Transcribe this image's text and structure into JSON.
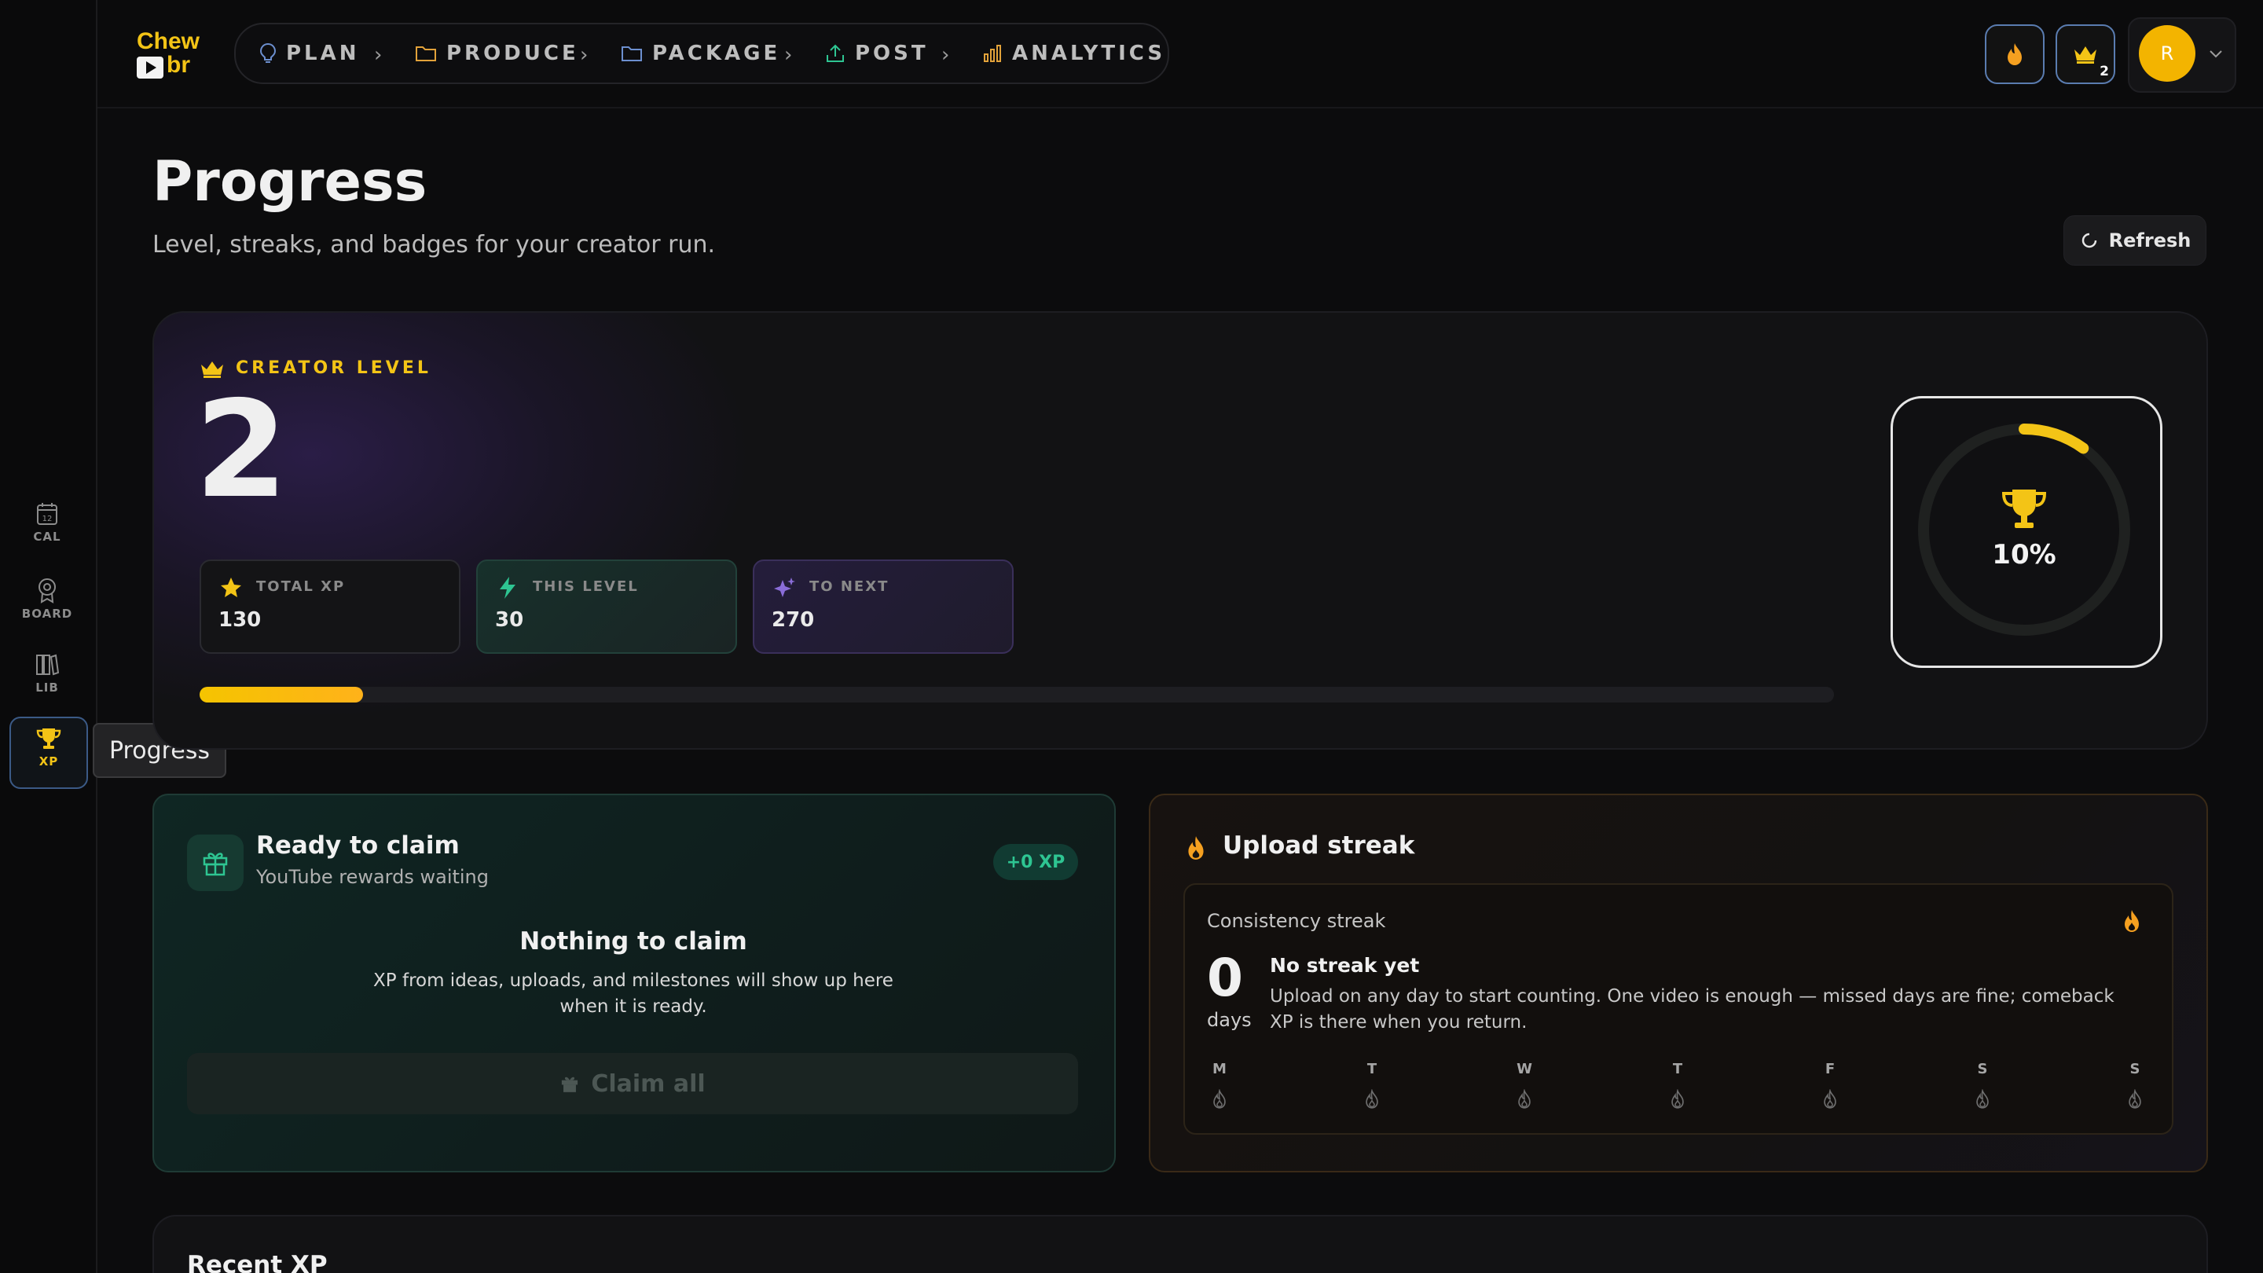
{
  "app": {
    "name": "Chewbr",
    "logo_line1": "Chew",
    "logo_line2": "br"
  },
  "nav": {
    "items": [
      {
        "label": "PLAN",
        "icon": "bulb-icon"
      },
      {
        "label": "PRODUCE",
        "icon": "folder-icon"
      },
      {
        "label": "PACKAGE",
        "icon": "folder-icon"
      },
      {
        "label": "POST",
        "icon": "upload-icon"
      },
      {
        "label": "ANALYTICS",
        "icon": "bar-chart-icon"
      }
    ]
  },
  "header_actions": {
    "streak_icon": "flame-icon",
    "level_icon": "crown-icon",
    "level_badge": "2",
    "avatar_initial": "R"
  },
  "rail": {
    "items": [
      {
        "label": "CAL",
        "icon": "calendar-icon"
      },
      {
        "label": "BOARD",
        "icon": "pin-icon"
      },
      {
        "label": "LIB",
        "icon": "library-icon"
      },
      {
        "label": "XP",
        "icon": "trophy-icon",
        "active": true
      }
    ],
    "tooltip": "Progress"
  },
  "page": {
    "title": "Progress",
    "subtitle": "Level, streaks, and badges for your creator run.",
    "refresh_label": "Refresh"
  },
  "level": {
    "label": "CREATOR LEVEL",
    "value": "2",
    "stats": [
      {
        "label": "TOTAL XP",
        "value": "130",
        "icon": "star-icon"
      },
      {
        "label": "THIS LEVEL",
        "value": "30",
        "icon": "bolt-icon"
      },
      {
        "label": "TO NEXT",
        "value": "270",
        "icon": "sparkle-icon"
      }
    ],
    "progress_fraction": 0.1,
    "ring_percent": "10%"
  },
  "claim": {
    "title": "Ready to claim",
    "subtitle": "YouTube rewards waiting",
    "pill": "+0 XP",
    "empty_title": "Nothing to claim",
    "empty_body": "XP from ideas, uploads, and milestones will show up here when it is ready.",
    "button_label": "Claim all"
  },
  "streak": {
    "title": "Upload streak",
    "inner_label": "Consistency streak",
    "count": "0",
    "unit": "days",
    "status_title": "No streak yet",
    "status_body": "Upload on any day to start counting. One video is enough — missed days are fine; comeback XP is there when you return.",
    "days": [
      "M",
      "T",
      "W",
      "T",
      "F",
      "S",
      "S"
    ]
  },
  "recent": {
    "title": "Recent XP"
  },
  "colors": {
    "accent": "#f3c416",
    "teal": "#2ec592",
    "purple": "#8a6dd8",
    "orange": "#f5a020"
  }
}
